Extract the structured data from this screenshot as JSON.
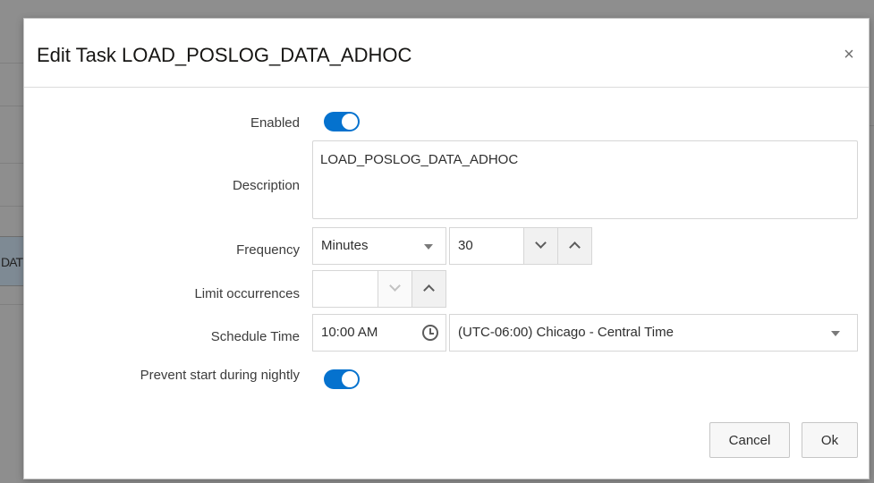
{
  "background": {
    "partial_cell_text": "DAT"
  },
  "dialog": {
    "title": "Edit Task LOAD_POSLOG_DATA_ADHOC",
    "close_glyph": "×"
  },
  "form": {
    "enabled": {
      "label": "Enabled",
      "value": true
    },
    "description": {
      "label": "Description",
      "value": "LOAD_POSLOG_DATA_ADHOC"
    },
    "frequency": {
      "label": "Frequency",
      "unit": "Minutes",
      "value": "30"
    },
    "limit_occurrences": {
      "label": "Limit occurrences",
      "value": ""
    },
    "schedule_time": {
      "label": "Schedule Time",
      "time": "10:00 AM",
      "timezone": "(UTC-06:00) Chicago - Central Time"
    },
    "prevent_start": {
      "label": "Prevent start during nightly",
      "value": true
    }
  },
  "buttons": {
    "cancel": "Cancel",
    "ok": "Ok"
  },
  "icons": {
    "close": "close-icon",
    "clock": "clock-icon",
    "caret": "caret-down-icon",
    "chevron_down": "chevron-down-icon",
    "chevron_up": "chevron-up-icon"
  },
  "colors": {
    "accent": "#0572ce",
    "backdrop": "#8e8e8e"
  }
}
